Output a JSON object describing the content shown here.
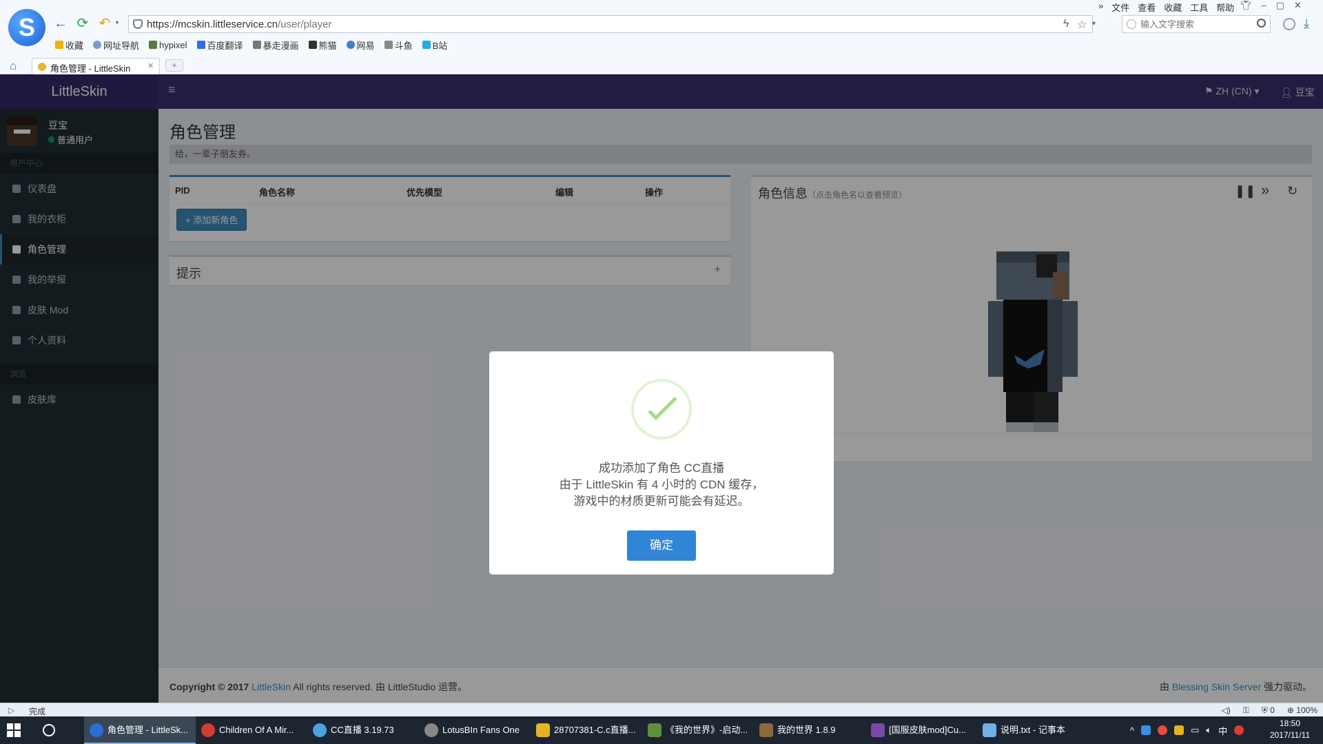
{
  "browser": {
    "url_host": "https://mcskin.littleservice.cn",
    "url_path": "/user/player",
    "search_placeholder": "输入文字搜索",
    "menu": [
      "»",
      "文件",
      "查看",
      "收藏",
      "工具",
      "帮助"
    ],
    "window_controls": [
      "–",
      "▢",
      "✕"
    ],
    "bookmarks": [
      {
        "label": "收藏",
        "icon": "star-icon"
      },
      {
        "label": "网址导航",
        "icon": "globe-icon"
      },
      {
        "label": "hypixel",
        "icon": "cube-icon"
      },
      {
        "label": "百度翻译",
        "icon": "translate-icon"
      },
      {
        "label": "暴走漫画",
        "icon": "comic-icon"
      },
      {
        "label": "熊猫",
        "icon": "panda-icon"
      },
      {
        "label": "网易",
        "icon": "netease-icon"
      },
      {
        "label": "斗鱼",
        "icon": "douyu-icon"
      },
      {
        "label": "B站",
        "icon": "bilibili-icon"
      }
    ],
    "tab_title": "角色管理 - LittleSkin",
    "new_tab": "+",
    "status_left": "完成",
    "status_right": [
      "◁)",
      "⚿",
      "0",
      "100%"
    ]
  },
  "app": {
    "brand": "LittleSkin",
    "menu_toggle": "≡",
    "lang": "ZH (CN) ▾",
    "user": "豆宝"
  },
  "sidebar": {
    "user_name": "豆宝",
    "user_status": "普通用户",
    "header_user": "用户中心",
    "header_browse": "浏览",
    "items": [
      {
        "label": "仪表盘",
        "icon": "dashboard-icon"
      },
      {
        "label": "我的衣柜",
        "icon": "star-icon"
      },
      {
        "label": "角色管理",
        "icon": "users-icon"
      },
      {
        "label": "我的举报",
        "icon": "flag-icon"
      },
      {
        "label": "皮肤 Mod",
        "icon": "book-icon"
      },
      {
        "label": "个人资料",
        "icon": "user-icon"
      },
      {
        "label": "皮肤库",
        "icon": "archive-icon"
      }
    ]
  },
  "content": {
    "title": "角色管理",
    "hint": "给，一辈子朋友券。",
    "table_headers": [
      "PID",
      "角色名称",
      "优先模型",
      "编辑",
      "操作"
    ],
    "add_button": "+ 添加新角色",
    "tips_title": "提示",
    "tips_expand": "+",
    "info_title": "角色信息",
    "info_subtitle": "（点击角色名以查看预览）",
    "info_buttons": [
      "❚❚",
      "»",
      "↻"
    ]
  },
  "footer": {
    "copyright": "Copyright © 2017",
    "brand_link": "LittleSkin",
    "rights": "All rights reserved. 由 LittleStudio 运营。",
    "powered_prefix": "由",
    "powered_link": "Blessing Skin Server",
    "powered_suffix": "强力驱动。"
  },
  "modal": {
    "line1": "成功添加了角色 CC直播",
    "line2": "由于 LittleSkin 有 4 小时的 CDN 缓存，",
    "line3": "游戏中的材质更新可能会有延迟。",
    "confirm": "确定"
  },
  "taskbar": {
    "tasks": [
      {
        "label": "角色管理 - LittleSk...",
        "icon": "sogou-icon",
        "color": "#2a6fd6"
      },
      {
        "label": "Children Of A Mir...",
        "icon": "netease-music-icon",
        "color": "#d43c33"
      },
      {
        "label": "CC直播 3.19.73",
        "icon": "cc-icon",
        "color": "#4aa3e0"
      },
      {
        "label": "LotusBIn Fans One",
        "icon": "lotus-icon",
        "color": "#888888"
      },
      {
        "label": "28707381-C.c直播...",
        "icon": "video-icon",
        "color": "#e6b422"
      },
      {
        "label": "《我的世界》-启动...",
        "icon": "minecraft-icon",
        "color": "#5f8f3a"
      },
      {
        "label": "我的世界 1.8.9",
        "icon": "minecraft-block-icon",
        "color": "#8a6a3d"
      },
      {
        "label": "[国服皮肤mod]Cu...",
        "icon": "winrar-icon",
        "color": "#7b4aa8"
      },
      {
        "label": "说明.txt - 记事本",
        "icon": "notepad-icon",
        "color": "#6fb0e8"
      }
    ],
    "tray": [
      "^",
      "中"
    ],
    "time": "18:50",
    "date": "2017/11/11"
  }
}
